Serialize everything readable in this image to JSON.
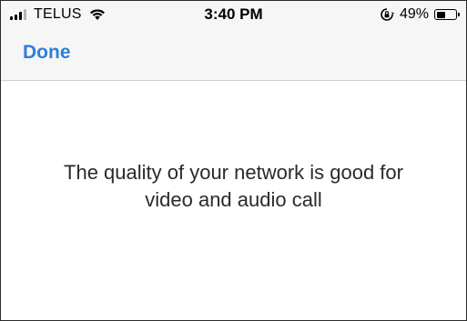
{
  "status_bar": {
    "carrier": "TELUS",
    "time": "3:40 PM",
    "battery_percent": "49%",
    "battery_level": 0.49,
    "signal_bars_filled": 3,
    "signal_bars_total": 4,
    "icons": {
      "signal": "cellular-signal-icon",
      "wifi": "wifi-icon",
      "orientation_lock": "orientation-lock-icon",
      "battery": "battery-icon"
    }
  },
  "nav": {
    "done_label": "Done"
  },
  "main": {
    "message": "The quality of your network is good for\nvideo and audio call"
  },
  "colors": {
    "accent": "#2f7fd6",
    "bar_background": "#f6f6f6",
    "text": "#2a2a2a"
  }
}
